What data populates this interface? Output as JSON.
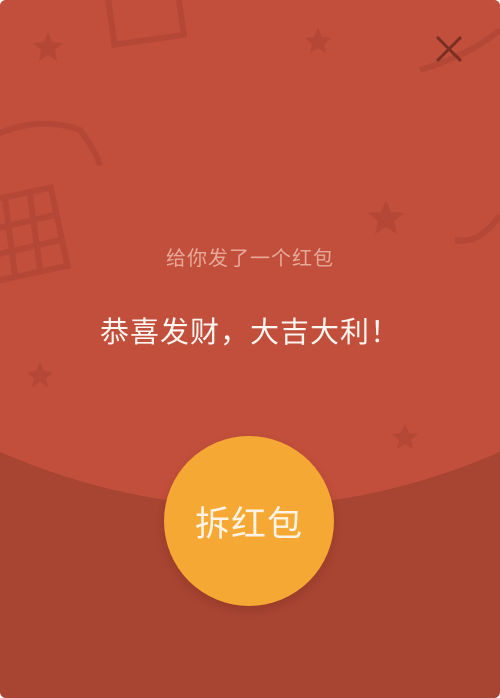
{
  "envelope": {
    "subtitle": "给你发了一个红包",
    "blessing": "恭喜发财，大吉大利！",
    "open_button_label": "拆红包",
    "close_icon": "close-icon"
  },
  "colors": {
    "envelope_top": "#c14f3c",
    "envelope_bottom": "#a74432",
    "decor": "#b44736",
    "open_button": "#f5a834",
    "subtitle_text": "#e9a999",
    "blessing_text": "#fff6f1",
    "close_icon": "#7a2e22"
  }
}
